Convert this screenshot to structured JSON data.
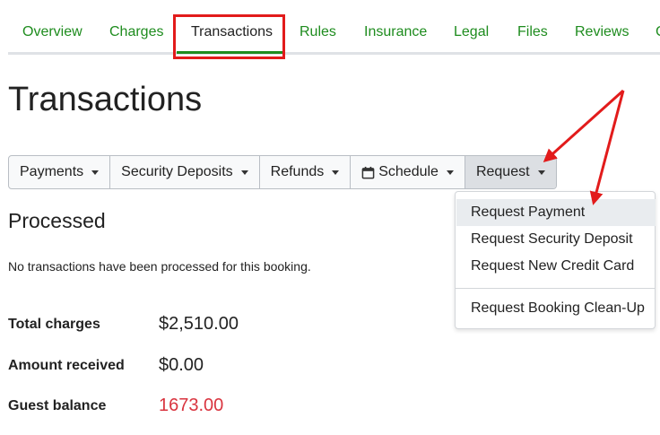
{
  "tabs": [
    {
      "label": "Overview"
    },
    {
      "label": "Charges"
    },
    {
      "label": "Transactions"
    },
    {
      "label": "Rules"
    },
    {
      "label": "Insurance"
    },
    {
      "label": "Legal"
    },
    {
      "label": "Files"
    },
    {
      "label": "Reviews"
    }
  ],
  "active_tab": "Transactions",
  "page_title": "Transactions",
  "toolbar": {
    "payments": "Payments",
    "security_deposits": "Security Deposits",
    "refunds": "Refunds",
    "schedule": "Schedule",
    "request": "Request"
  },
  "request_menu": {
    "items": [
      "Request Payment",
      "Request Security Deposit",
      "Request New Credit Card",
      "Request Booking Clean-Up"
    ],
    "highlighted": "Request Payment"
  },
  "processed": {
    "title": "Processed",
    "empty_message": "No transactions have been processed for this booking."
  },
  "summary": {
    "total_charges_label": "Total charges",
    "total_charges_value": "$2,510.00",
    "amount_received_label": "Amount received",
    "amount_received_value": "$0.00",
    "guest_balance_label": "Guest balance",
    "guest_balance_value": "1673.00"
  },
  "colors": {
    "link_green": "#1e8c1e",
    "annotation_red": "#e21b1b",
    "balance_red": "#d9343f"
  },
  "icons": [
    "calendar-icon",
    "caret-down-icon"
  ]
}
